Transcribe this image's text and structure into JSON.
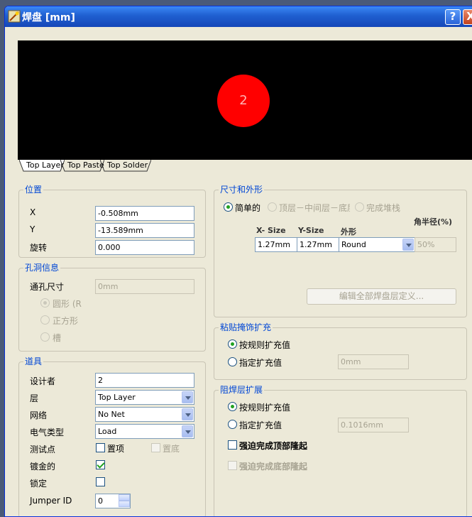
{
  "window": {
    "title": "焊盘 [mm]",
    "help_label": "?",
    "close_label": "X"
  },
  "preview": {
    "pad_label": "2",
    "pad_color": "#ff0000",
    "background": "#000000"
  },
  "layer_tabs": [
    "Top Layer",
    "Top Paste",
    "Top Solder"
  ],
  "position": {
    "title": "位置",
    "x_label": "X",
    "x_value": "-0.508mm",
    "y_label": "Y",
    "y_value": "-13.589mm",
    "rotation_label": "旋转",
    "rotation_value": "0.000"
  },
  "hole": {
    "title": "孔洞信息",
    "size_label": "通孔尺寸",
    "size_value": "0mm",
    "shape_round": "圆形 (R",
    "shape_square": "正方形",
    "shape_slot": "槽"
  },
  "properties": {
    "title": "道具",
    "designator_label": "设计者",
    "designator_value": "2",
    "layer_label": "层",
    "layer_value": "Top Layer",
    "net_label": "网络",
    "net_value": "No Net",
    "elec_type_label": "电气类型",
    "elec_type_value": "Load",
    "testpoint_label": "测试点",
    "testpoint_top": "置项",
    "testpoint_bottom": "置底",
    "plated_label": "镀金的",
    "plated_checked": true,
    "locked_label": "锁定",
    "locked_checked": false,
    "jumper_label": "Jumper ID",
    "jumper_value": "0"
  },
  "size_shape": {
    "title": "尺寸和外形",
    "mode_simple": "简单的",
    "mode_tmb": "顶层－中间层－底层",
    "mode_full": "完成堆栈",
    "corner_radius_header": "角半径(%)",
    "col_x": "X- Size",
    "col_y": "Y-Size",
    "col_shape": "外形",
    "x_value": "1.27mm",
    "y_value": "1.27mm",
    "shape_value": "Round",
    "corner_value": "50%",
    "edit_all_button": "编辑全部焊盘层定义..."
  },
  "paste_mask": {
    "title": "粘贴掩饰扩充",
    "by_rule": "按规则扩充值",
    "specified": "指定扩充值",
    "value": "0mm"
  },
  "solder_mask": {
    "title": "阻焊层扩展",
    "by_rule": "按规则扩充值",
    "specified": "指定扩充值",
    "value": "0.1016mm",
    "force_top": "强迫完成顶部隆起",
    "force_bottom": "强迫完成底部隆起"
  }
}
